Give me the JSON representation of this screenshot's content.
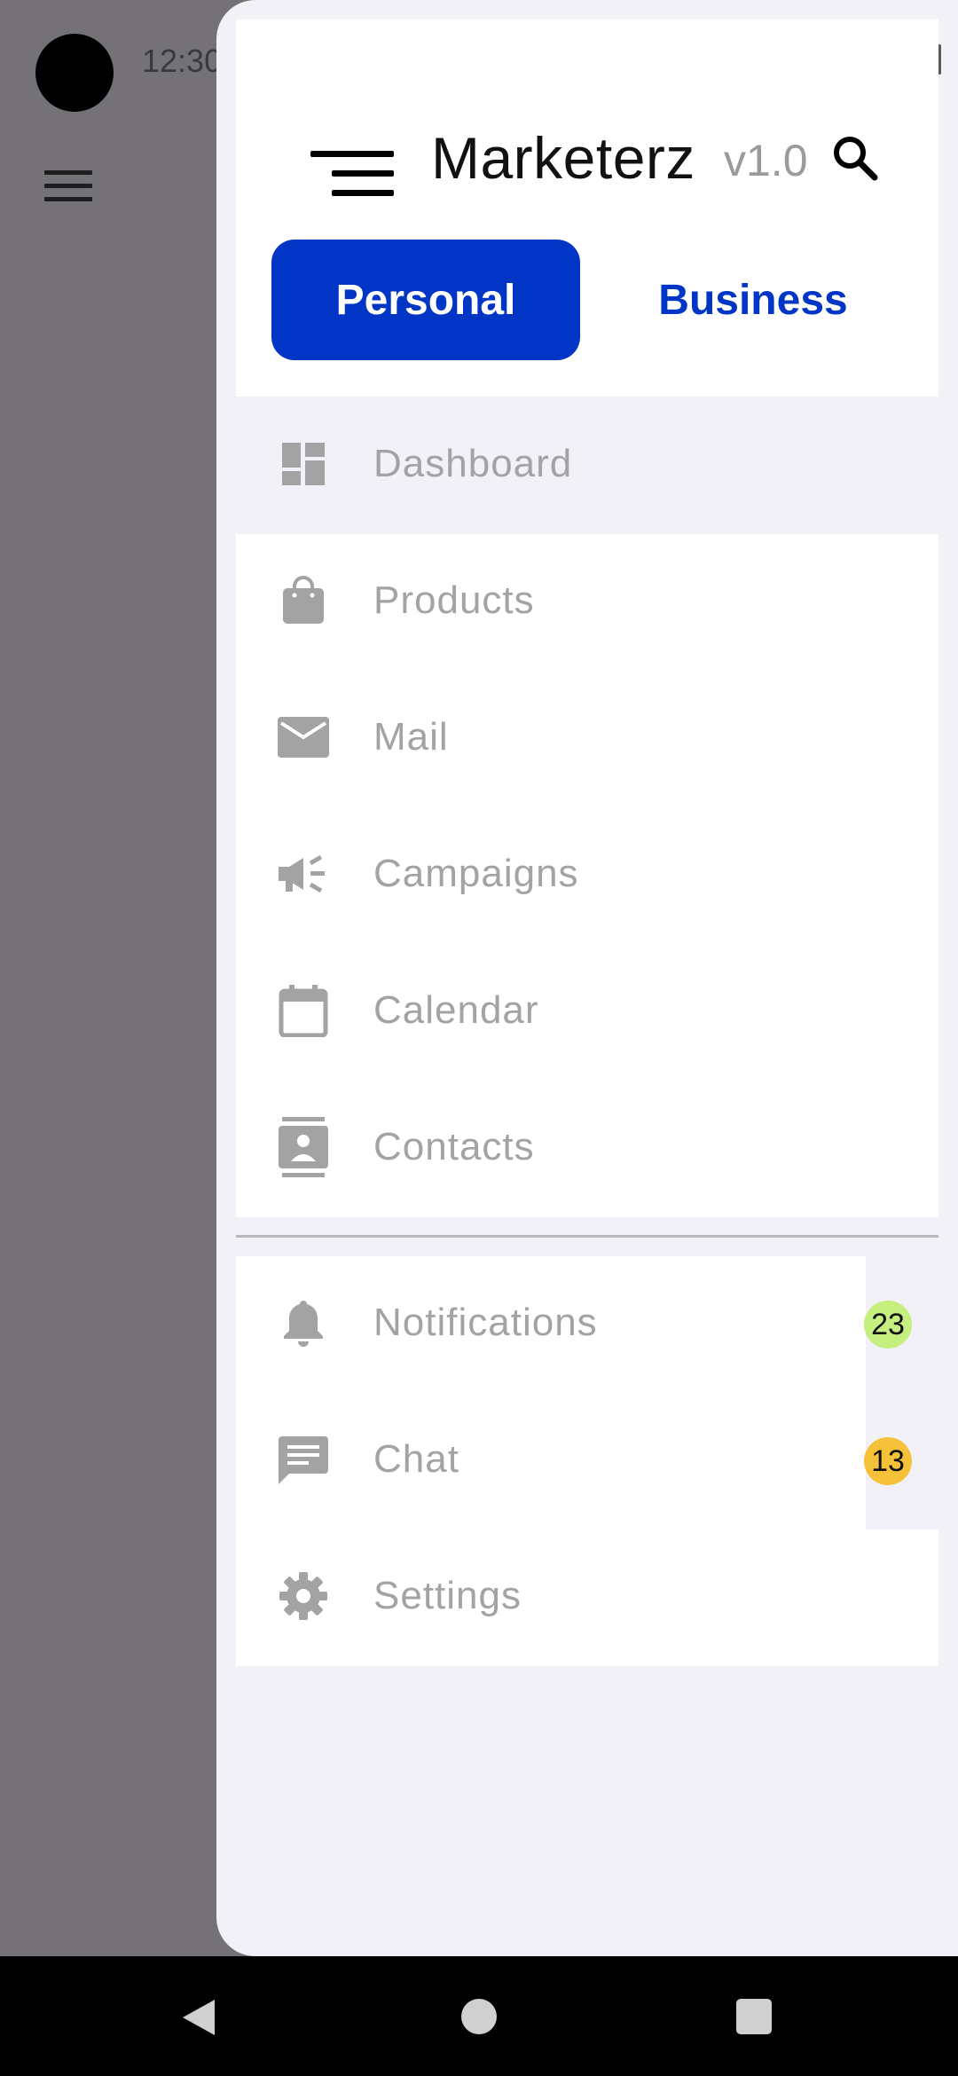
{
  "status_bar": {
    "time": "12:30"
  },
  "drawer": {
    "app_title": "Marketerz",
    "version": "v1.0",
    "tabs": [
      {
        "label": "Personal",
        "selected": true
      },
      {
        "label": "Business",
        "selected": false
      }
    ],
    "items": [
      {
        "label": "Dashboard",
        "icon": "dashboard-icon"
      },
      {
        "label": "Products",
        "icon": "shopping-bag-icon"
      },
      {
        "label": "Mail",
        "icon": "mail-icon"
      },
      {
        "label": "Campaigns",
        "icon": "campaign-icon"
      },
      {
        "label": "Calendar",
        "icon": "calendar-icon"
      },
      {
        "label": "Contacts",
        "icon": "contacts-icon"
      },
      {
        "label": "Notifications",
        "icon": "bell-icon",
        "badge": "23",
        "badge_color": "#c5ef7f"
      },
      {
        "label": "Chat",
        "icon": "chat-icon",
        "badge": "13",
        "badge_color": "#f4c138"
      },
      {
        "label": "Settings",
        "icon": "gear-icon"
      }
    ]
  },
  "colors": {
    "accent": "#0035c5",
    "scrim": "#747276",
    "drawer_bg": "#f3f1f8",
    "label_gray": "#a3a3a3"
  }
}
